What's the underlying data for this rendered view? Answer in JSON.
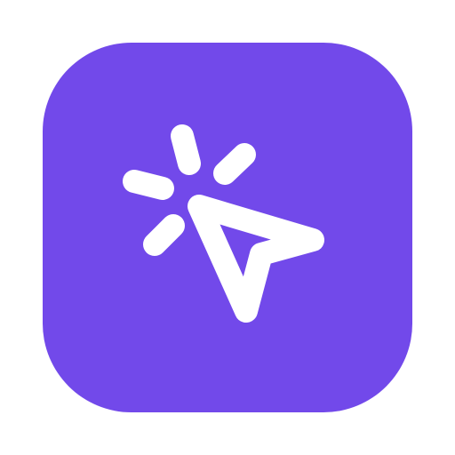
{
  "icon": {
    "name": "cursor-click-icon",
    "background_color": "#7249EA",
    "glyph_color": "#FFFFFF"
  }
}
